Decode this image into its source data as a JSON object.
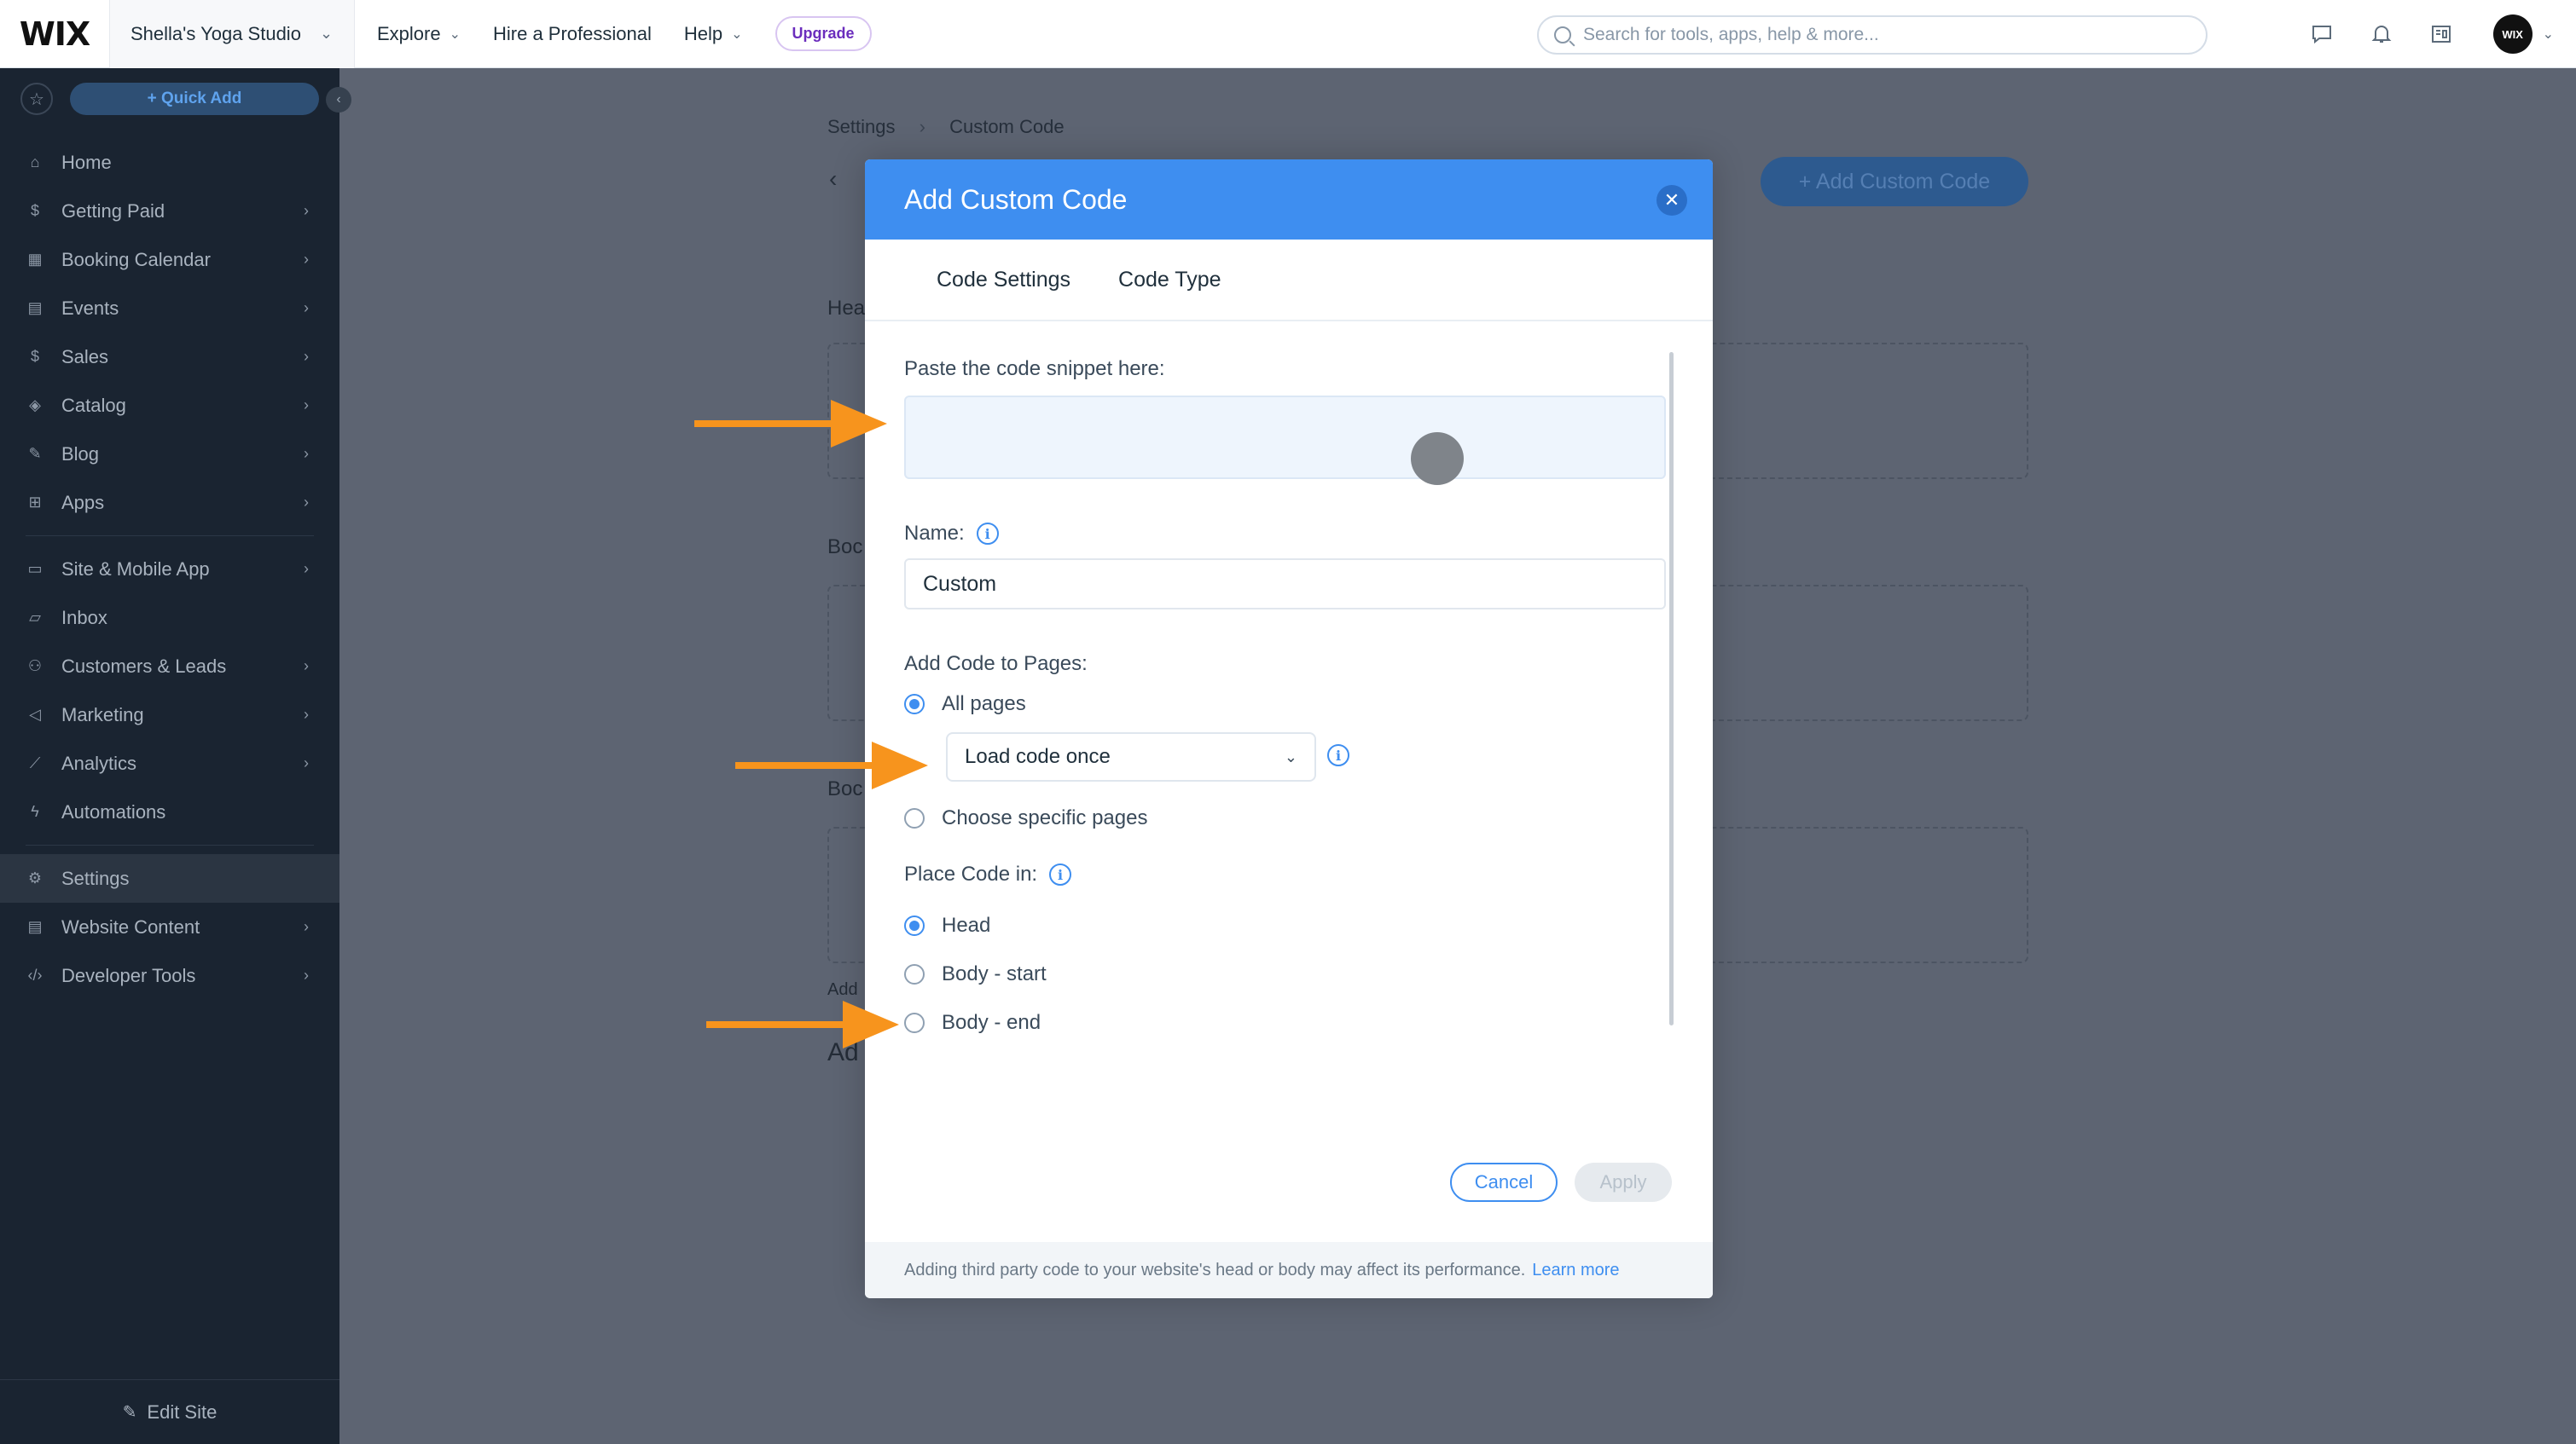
{
  "topbar": {
    "logo": "WIX",
    "site_name": "Shella's Yoga Studio",
    "nav": [
      {
        "label": "Explore",
        "has_dropdown": true
      },
      {
        "label": "Hire a Professional",
        "has_dropdown": false
      },
      {
        "label": "Help",
        "has_dropdown": true
      }
    ],
    "upgrade_label": "Upgrade",
    "search_placeholder": "Search for tools, apps, help & more...",
    "avatar_text": "WIX"
  },
  "sidebar": {
    "quick_add": "+ Quick Add",
    "items": [
      {
        "label": "Home",
        "icon": "home-icon"
      },
      {
        "label": "Getting Paid",
        "icon": "dollar-doc-icon"
      },
      {
        "label": "Booking Calendar",
        "icon": "calendar-icon"
      },
      {
        "label": "Events",
        "icon": "events-icon"
      },
      {
        "label": "Sales",
        "icon": "sales-icon"
      },
      {
        "label": "Catalog",
        "icon": "catalog-icon"
      },
      {
        "label": "Blog",
        "icon": "blog-icon"
      },
      {
        "label": "Apps",
        "icon": "apps-icon"
      },
      {
        "label": "Site & Mobile App",
        "icon": "site-icon"
      },
      {
        "label": "Inbox",
        "icon": "inbox-icon"
      },
      {
        "label": "Customers & Leads",
        "icon": "customers-icon"
      },
      {
        "label": "Marketing",
        "icon": "marketing-icon"
      },
      {
        "label": "Analytics",
        "icon": "analytics-icon"
      },
      {
        "label": "Automations",
        "icon": "automations-icon"
      },
      {
        "label": "Settings",
        "icon": "settings-icon"
      },
      {
        "label": "Website Content",
        "icon": "content-icon"
      },
      {
        "label": "Developer Tools",
        "icon": "code-icon"
      }
    ],
    "edit_site": "Edit Site"
  },
  "background": {
    "breadcrumb": [
      "Settings",
      "Custom Code"
    ],
    "add_custom_code": "+ Add Custom Code",
    "section_labels": [
      "Hea",
      "Boc",
      "Boc",
      "Add",
      "Ad"
    ]
  },
  "modal": {
    "title": "Add Custom Code",
    "tabs": [
      "Code Settings",
      "Code Type"
    ],
    "paste_label": "Paste the code snippet here:",
    "name_label": "Name:",
    "name_value": "Custom",
    "add_to_pages_label": "Add Code to Pages:",
    "all_pages": "All pages",
    "load_option": "Load code once",
    "specific_pages": "Choose specific pages",
    "place_label": "Place Code in:",
    "place_options": [
      "Head",
      "Body - start",
      "Body - end"
    ],
    "cancel": "Cancel",
    "apply": "Apply",
    "footer_text": "Adding third party code to your website's head or body may affect its performance.",
    "footer_link": "Learn more"
  },
  "colors": {
    "accent": "#3e8ef0",
    "annotation_arrow": "#f7941d",
    "sidebar_bg": "#1a2431"
  }
}
